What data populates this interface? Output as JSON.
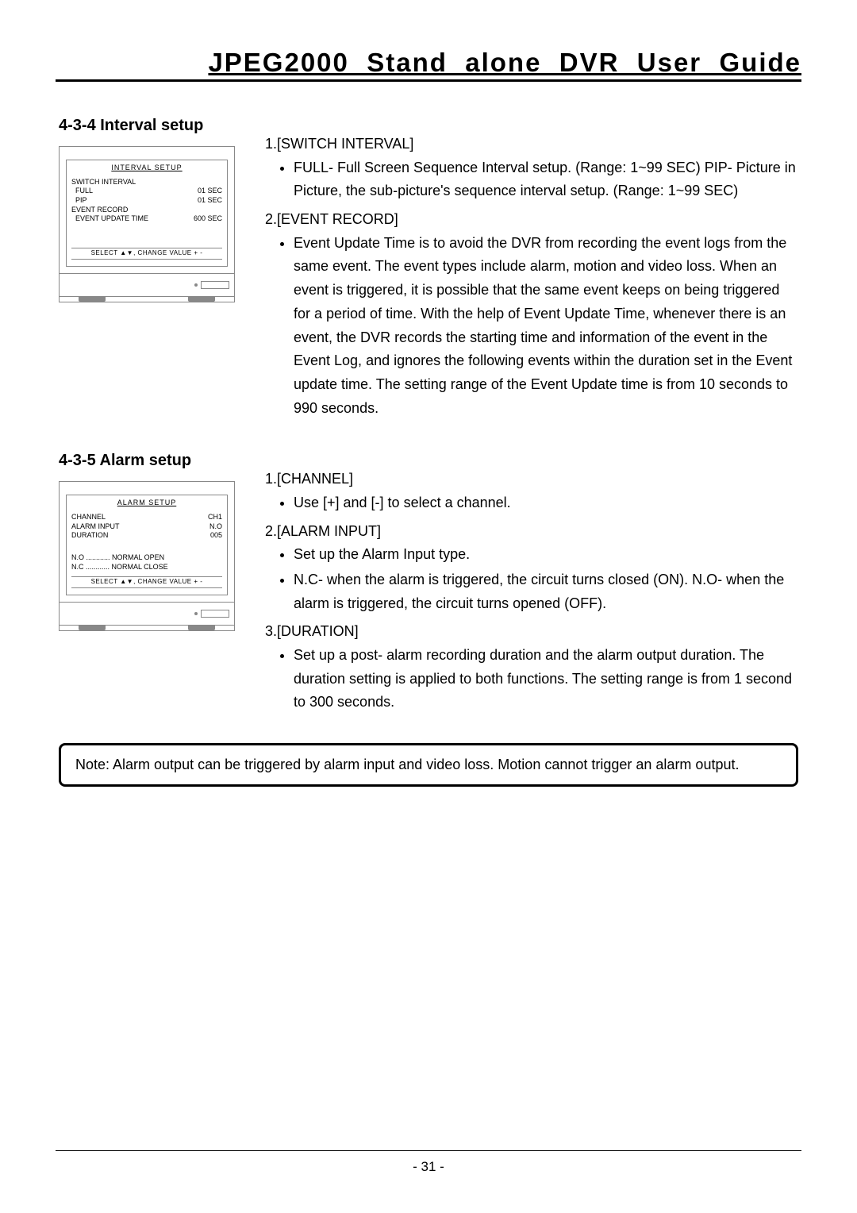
{
  "doc_title": "JPEG2000  Stand  alone  DVR  User  Guide",
  "page_number": "- 31 -",
  "sections": {
    "interval": {
      "heading": "4-3-4 Interval setup",
      "menu": {
        "title": "INTERVAL SETUP",
        "rows": [
          {
            "label": "SWITCH INTERVAL",
            "val": ""
          },
          {
            "label": "  FULL",
            "val": "01 SEC"
          },
          {
            "label": "  PIP",
            "val": "01 SEC"
          },
          {
            "label": "EVENT RECORD",
            "val": ""
          },
          {
            "label": "  EVENT UPDATE TIME",
            "val": "600 SEC"
          }
        ],
        "legend": "SELECT ▲▼, CHANGE VALUE + -"
      },
      "items": [
        {
          "label": "1.[SWITCH INTERVAL]",
          "bullets": [
            "FULL- Full Screen Sequence Interval setup. (Range: 1~99 SEC) PIP- Picture in Picture, the sub-picture's sequence interval setup. (Range: 1~99 SEC)"
          ]
        },
        {
          "label": "2.[EVENT RECORD]",
          "bullets": [
            "Event Update Time is to avoid the DVR from recording the event logs from the same event. The event types include alarm, motion and video loss. When an event is triggered, it is possible that the same event keeps on being triggered for a period of time. With the help of Event Update Time, whenever there is an event, the DVR records the starting time and information of the event in the Event Log, and ignores the following events within the duration set in the Event update time. The setting range of the Event Update time is from 10 seconds to 990 seconds."
          ]
        }
      ]
    },
    "alarm": {
      "heading": "4-3-5 Alarm setup",
      "menu": {
        "title": "ALARM SETUP",
        "rows": [
          {
            "label": "CHANNEL",
            "val": "CH1"
          },
          {
            "label": "ALARM INPUT",
            "val": "N.O"
          },
          {
            "label": "DURATION",
            "val": "005"
          }
        ],
        "notes": [
          "N.O ............ NORMAL OPEN",
          "N.C ............ NORMAL CLOSE"
        ],
        "legend": "SELECT ▲▼, CHANGE VALUE + -"
      },
      "items": [
        {
          "label": "1.[CHANNEL]",
          "bullets": [
            "Use [+] and [-] to select a channel."
          ]
        },
        {
          "label": "2.[ALARM INPUT]",
          "bullets": [
            "Set up the Alarm Input type.",
            "N.C- when the alarm is triggered, the circuit turns closed (ON). N.O- when the alarm is triggered, the circuit turns opened (OFF)."
          ]
        },
        {
          "label": "3.[DURATION]",
          "bullets": [
            "Set up a post- alarm recording duration and the alarm output duration. The duration setting is applied to both functions. The setting range is from 1 second to 300 seconds."
          ]
        }
      ]
    }
  },
  "note": "Note: Alarm output can be triggered by alarm input and video loss. Motion cannot trigger an alarm output."
}
